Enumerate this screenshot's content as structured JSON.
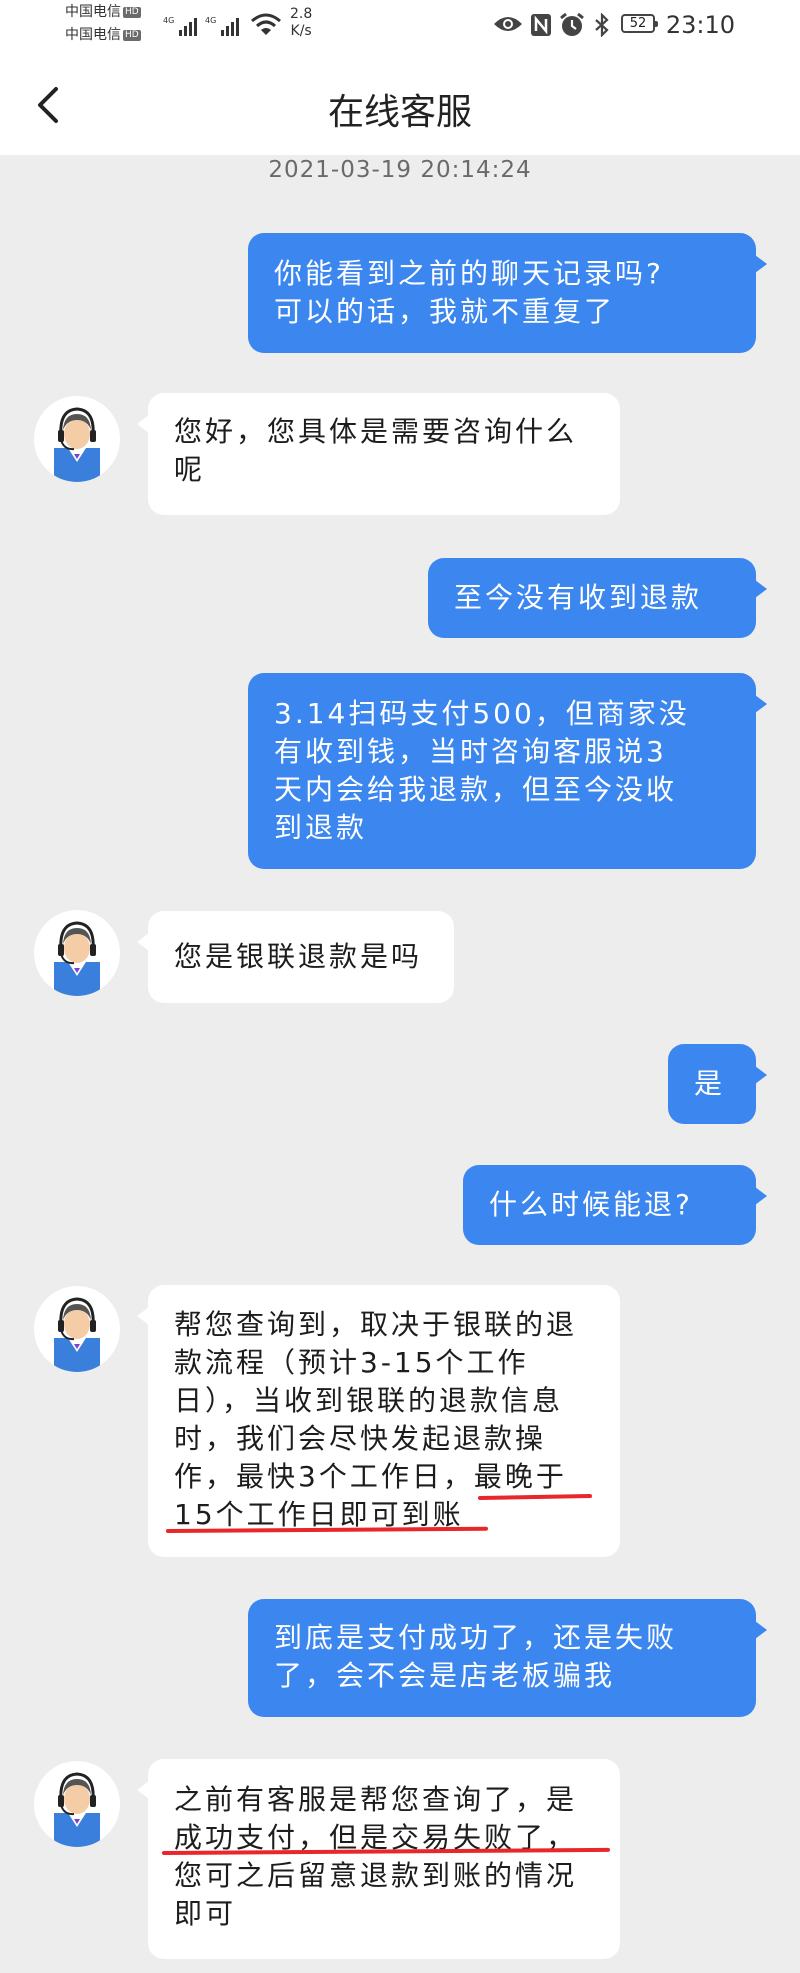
{
  "status_bar": {
    "carrier1": "中国电信",
    "carrier2": "中国电信",
    "hd_badge": "HD",
    "net1": "4G",
    "net2": "4G",
    "speed_value": "2.8",
    "speed_unit": "K/s",
    "battery": "52",
    "time": "23:10"
  },
  "header": {
    "title": "在线客服"
  },
  "chat": {
    "timestamp": "2021-03-19 20:14:24",
    "messages": [
      {
        "from": "user",
        "lines": [
          "你能看到之前的聊天记录吗?",
          "可以的话，我就不重复了"
        ]
      },
      {
        "from": "agent",
        "lines": [
          "您好，您具体是需要咨询什么",
          "呢"
        ]
      },
      {
        "from": "user",
        "lines": [
          "至今没有收到退款"
        ]
      },
      {
        "from": "user",
        "lines": [
          "3.14扫码支付500，但商家没",
          "有收到钱，当时咨询客服说3",
          "天内会给我退款，但至今没收",
          "到退款"
        ]
      },
      {
        "from": "agent",
        "lines": [
          "您是银联退款是吗"
        ]
      },
      {
        "from": "user",
        "lines": [
          "是"
        ]
      },
      {
        "from": "user",
        "lines": [
          "什么时候能退?"
        ]
      },
      {
        "from": "agent",
        "lines": [
          "帮您查询到，取决于银联的退",
          "款流程（预计3-15个工作",
          "日），当收到银联的退款信息",
          "时，我们会尽快发起退款操",
          "作，最快3个工作日，最晚于",
          "15个工作日即可到账"
        ]
      },
      {
        "from": "user",
        "lines": [
          "到底是支付成功了，还是失败",
          "了，会不会是店老板骗我"
        ]
      },
      {
        "from": "agent",
        "lines": [
          "之前有客服是帮您查询了，是",
          "成功支付，但是交易失败了，",
          "您可之后留意退款到账的情况",
          "即可"
        ]
      }
    ]
  },
  "colors": {
    "user_bubble": "#3b86ef",
    "agent_bubble": "#ffffff",
    "background": "#ededed",
    "annotation": "#e8262b"
  },
  "icons": [
    "back-arrow-icon",
    "eye-icon",
    "nfc-icon",
    "alarm-icon",
    "bluetooth-icon",
    "battery-icon",
    "wifi-icon",
    "signal-icon",
    "customer-service-avatar-icon"
  ]
}
